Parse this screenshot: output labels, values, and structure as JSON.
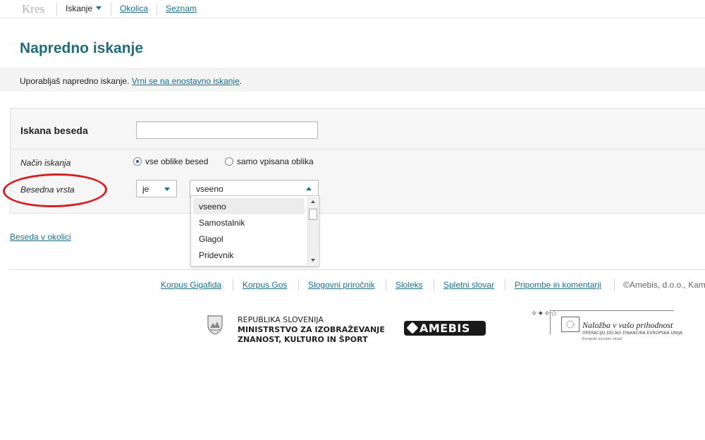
{
  "nav": {
    "brand": "Kres",
    "items": [
      {
        "label": "Iskanje"
      },
      {
        "label": "Okolica"
      },
      {
        "label": "Seznam"
      }
    ]
  },
  "title": "Napredno iskanje",
  "info": {
    "text": "Uporabljaš napredno iskanje. ",
    "link": "Vrni se na enostavno iskanje",
    "suffix": "."
  },
  "form": {
    "search_label": "Iskana beseda",
    "search_value": "",
    "mode_label": "Način iskanja",
    "mode_options": [
      "vse oblike besed",
      "samo vpisana oblika"
    ],
    "mode_selected": "vse oblike besed",
    "pos_label": "Besedna vrsta",
    "pos_operator": "je",
    "pos_value": "vseeno",
    "pos_options": [
      "vseeno",
      "Samostalnik",
      "Glagol",
      "Pridevnik"
    ]
  },
  "context_link": "Beseda v okolici",
  "footer": {
    "links": [
      "Korpus Gigafida",
      "Korpus Gos",
      "Slogovni priročnik",
      "Sloleks",
      "Spletni slovar",
      "Pripombe in komentarji"
    ],
    "copyright": "©Amebis, d.o.o., Kam"
  },
  "logos": {
    "ministry": [
      "REPUBLIKA SLOVENIJA",
      "MINISTRSTVO ZA IZOBRAŽEVANJE",
      "ZNANOST, KULTURO IN ŠPORT"
    ],
    "amebis": "AMEBIS",
    "eu_title": "Naložba v vašo prihodnost",
    "eu_sub": "Operacijo delno financira Evropska unija",
    "eu_fund": "Evropski socialni sklad"
  },
  "colors": {
    "link": "#1d6f8a",
    "title": "#1f6c7c",
    "annotation": "#d42020"
  }
}
